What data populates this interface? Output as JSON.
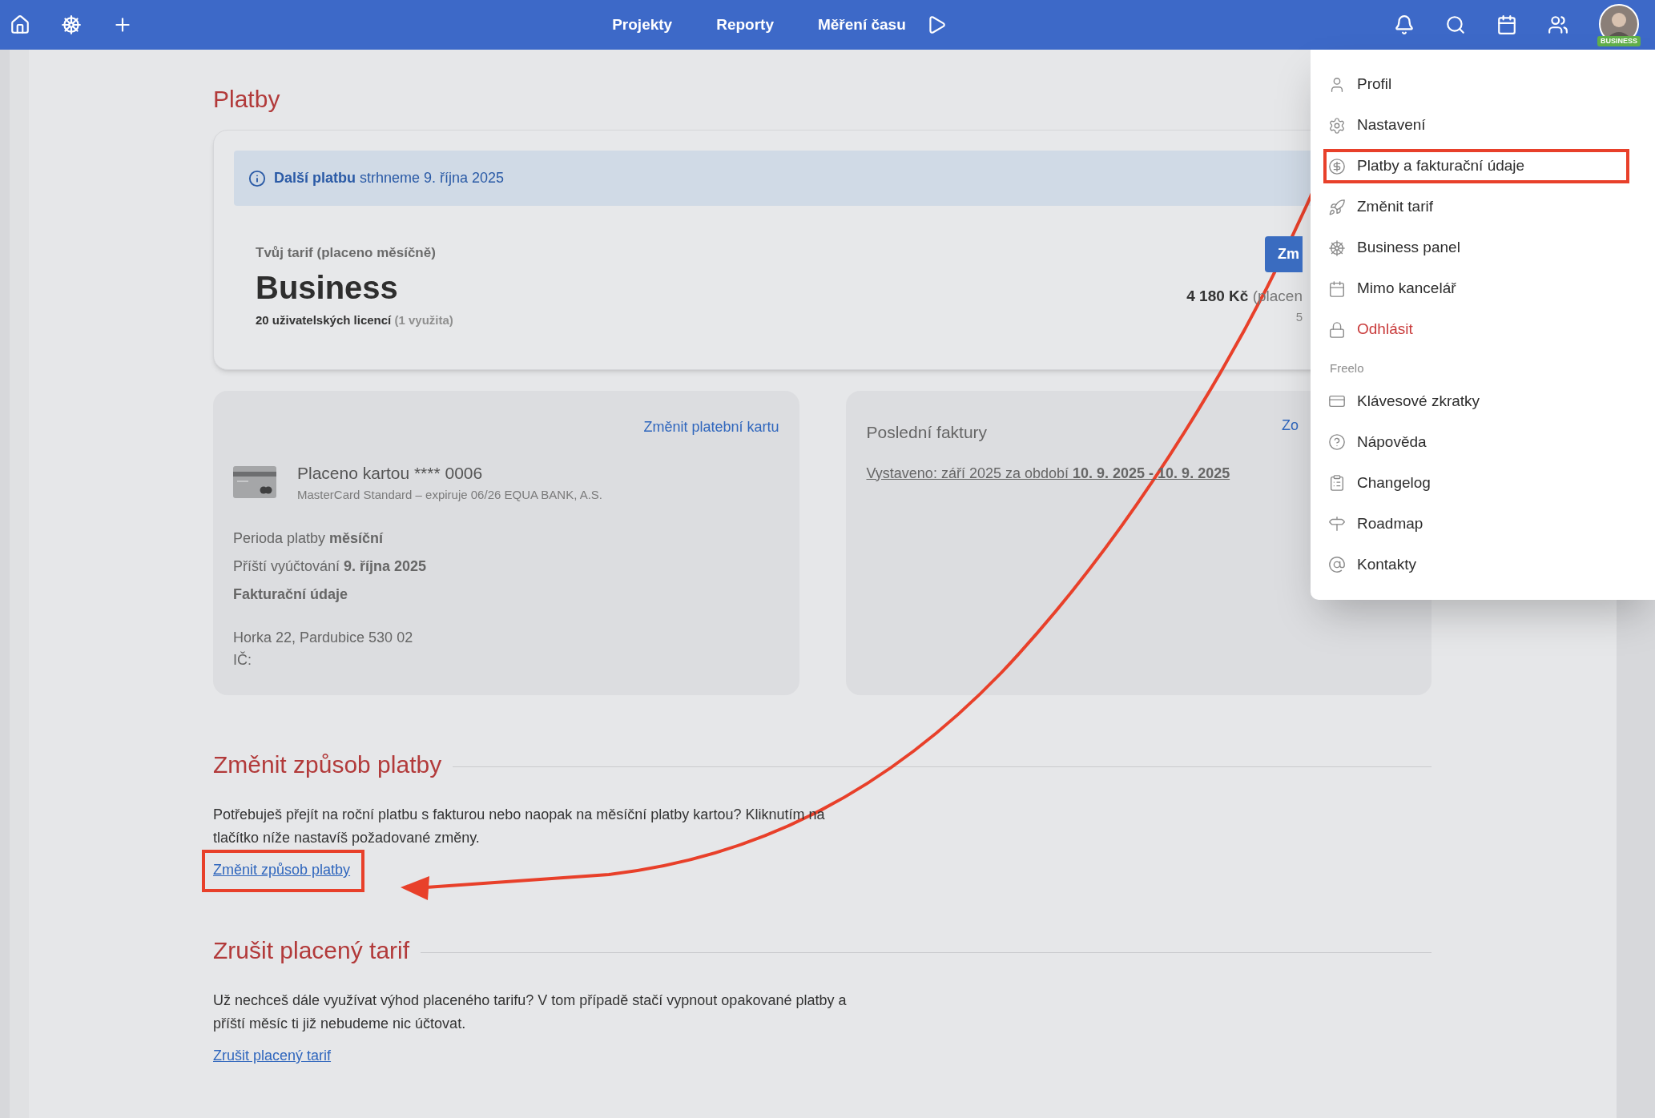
{
  "topbar": {
    "nav": [
      {
        "label": "Projekty"
      },
      {
        "label": "Reporty"
      },
      {
        "label": "Měření času"
      }
    ],
    "avatar_badge": "BUSINESS"
  },
  "page_title": "Platby",
  "plan_card": {
    "banner": "**Další platbu** strhneme 9. října 2025",
    "tariff_label": "Tvůj tarif (placeno měsíčně)",
    "tariff_name": "Business",
    "licenses": "20 uživatelských licencí",
    "licenses_used": "(1 využita)",
    "button": "Zm",
    "price": "4 180 Kč",
    "price_note": "(placen",
    "price_sub": "5"
  },
  "payment_card": {
    "link": "Změnit platební kartu",
    "card_title": "Placeno kartou **** 0006",
    "card_detail": "MasterCard Standard – expiruje 06/26 EQUA BANK, A.S.",
    "lines": [
      "Perioda platby **měsíční**",
      "Příští vyúčtování **9. října 2025**"
    ],
    "billing_heading": "Fakturační údaje",
    "address": "Horka 22, Pardubice 530 02",
    "ic_label": "IČ:"
  },
  "invoices_card": {
    "title": "Poslední faktury",
    "link": "Zo",
    "invoice": "Vystaveno: září 2025 za období **10. 9. 2025 - 10. 9. 2025**"
  },
  "sections": [
    {
      "heading": "Změnit způsob platby",
      "text": "Potřebuješ přejít na roční platbu s fakturou nebo naopak na měsíční platby kartou? Kliknutím na tlačítko níže nastavíš požadované změny.",
      "link": "Změnit způsob platby",
      "highlighted": true
    },
    {
      "heading": "Zrušit placený tarif",
      "text": "Už nechceš dále využívat výhod placeného tarifu? V tom případě stačí vypnout opakované platby a příští měsíc ti již nebudeme nic účtovat.",
      "link": "Zrušit placený tarif",
      "highlighted": false
    }
  ],
  "user_menu": {
    "groups": [
      {
        "items": [
          {
            "label": "Profil",
            "danger": false,
            "highlighted": false
          },
          {
            "label": "Nastavení",
            "danger": false,
            "highlighted": false
          },
          {
            "label": "Platby a fakturační údaje",
            "danger": false,
            "highlighted": true
          },
          {
            "label": "Změnit tarif",
            "danger": false,
            "highlighted": false
          },
          {
            "label": "Business panel",
            "danger": false,
            "highlighted": false
          },
          {
            "label": "Mimo kancelář",
            "danger": false,
            "highlighted": false
          },
          {
            "label": "Odhlásit",
            "danger": true,
            "highlighted": false
          }
        ]
      },
      {
        "label": "Freelo",
        "items": [
          {
            "label": "Klávesové zkratky",
            "danger": false,
            "highlighted": false
          },
          {
            "label": "Nápověda",
            "danger": false,
            "highlighted": false
          },
          {
            "label": "Changelog",
            "danger": false,
            "highlighted": false
          },
          {
            "label": "Roadmap",
            "danger": false,
            "highlighted": false
          },
          {
            "label": "Kontakty",
            "danger": false,
            "highlighted": false
          }
        ]
      }
    ]
  }
}
